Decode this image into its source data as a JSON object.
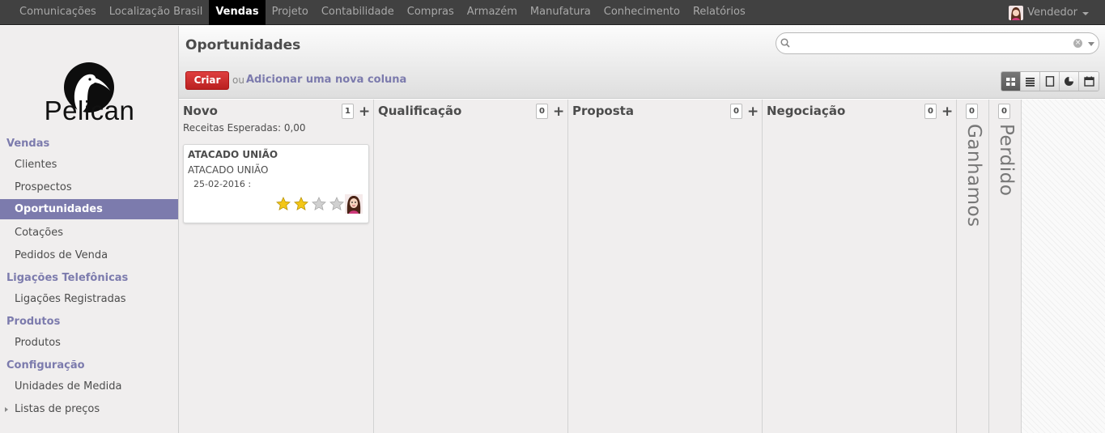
{
  "top_menu": {
    "items": [
      "Comunicações",
      "Localização Brasil",
      "Vendas",
      "Projeto",
      "Contabilidade",
      "Compras",
      "Armazém",
      "Manufatura",
      "Conhecimento",
      "Relatórios"
    ],
    "active": "Vendas",
    "user_name": "Vendedor"
  },
  "sidebar": {
    "logo_text": "Pelican",
    "sections": [
      {
        "title": "Vendas",
        "items": [
          "Clientes",
          "Prospectos",
          "Oportunidades",
          "Cotações",
          "Pedidos de Venda"
        ]
      },
      {
        "title": "Ligações Telefônicas",
        "items": [
          "Ligações Registradas"
        ]
      },
      {
        "title": "Produtos",
        "items": [
          "Produtos"
        ]
      },
      {
        "title": "Configuração",
        "items": [
          "Unidades de Medida",
          "Listas de preços"
        ]
      }
    ],
    "active_item": "Oportunidades"
  },
  "header": {
    "title": "Oportunidades",
    "search_placeholder": "",
    "create_label": "Criar",
    "or_label": "ou",
    "add_column_label": "Adicionar uma nova coluna",
    "views": [
      "kanban-icon",
      "list-icon",
      "form-icon",
      "graph-icon",
      "calendar-icon"
    ],
    "active_view": "kanban-icon"
  },
  "kanban": {
    "columns": [
      {
        "title": "Novo",
        "count": "1",
        "subtitle": "Receitas Esperadas: 0,00"
      },
      {
        "title": "Qualificação",
        "count": "0"
      },
      {
        "title": "Proposta",
        "count": "0"
      },
      {
        "title": "Negociação",
        "count": "0"
      }
    ],
    "folded_columns": [
      {
        "title": "Ganhamos",
        "count": "0"
      },
      {
        "title": "Perdido",
        "count": "0"
      }
    ],
    "card": {
      "title": "ATACADO UNIÃO",
      "partner": "ATACADO UNIÃO",
      "date": "25-02-2016 :",
      "rating": 2,
      "rating_max": 4
    }
  },
  "colors": {
    "accent": "#7c7bad",
    "create_button": "#dc1f1f",
    "topbar": "#414141"
  }
}
